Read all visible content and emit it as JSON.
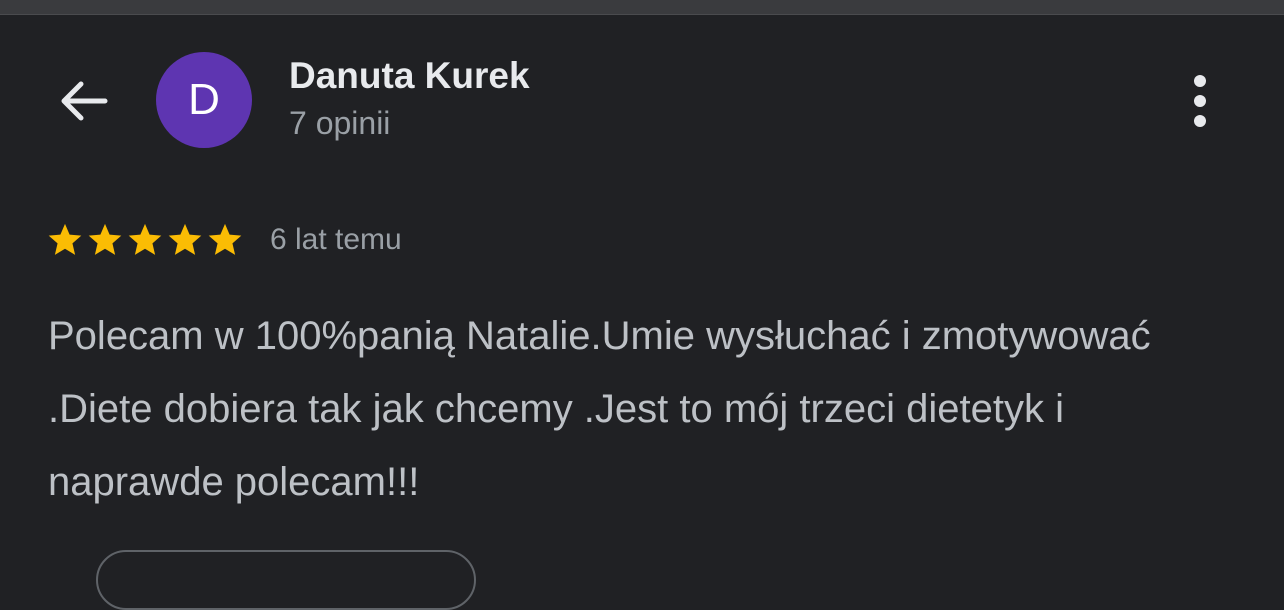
{
  "reviewer": {
    "name": "Danuta Kurek",
    "review_count": "7 opinii",
    "avatar_letter": "D",
    "avatar_color": "#5e35b1"
  },
  "review": {
    "rating": 5,
    "max_rating": 5,
    "star_color": "#fbbc04",
    "date": "6 lat temu",
    "text": "Polecam w 100%panią Natalie.Umie wysłuchać i zmotywować .Diete dobiera tak jak chcemy .Jest to mój trzeci dietetyk i naprawde polecam!!!"
  },
  "icons": {
    "back": "arrow-back-icon",
    "more": "more-vert-icon",
    "star": "star-icon"
  }
}
